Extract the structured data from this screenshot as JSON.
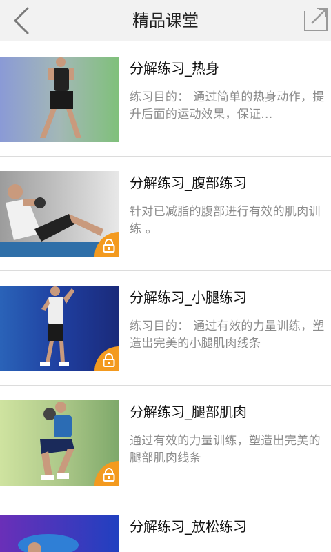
{
  "header": {
    "title": "精品课堂",
    "back_icon": "chevron-left-icon",
    "share_icon": "share-icon"
  },
  "lessons": [
    {
      "title": "分解练习_热身",
      "desc": "练习目的： 通过简单的热身动作，提升后面的运动效果，保证...",
      "locked": false
    },
    {
      "title": "分解练习_腹部练习",
      "desc": "针对已减脂的腹部进行有效的肌肉训练 。",
      "locked": true
    },
    {
      "title": "分解练习_小腿练习",
      "desc": "练习目的： 通过有效的力量训练，塑造出完美的小腿肌肉线条",
      "locked": true
    },
    {
      "title": "分解练习_腿部肌肉",
      "desc": "通过有效的力量训练，塑造出完美的腿部肌肉线条",
      "locked": true
    },
    {
      "title": "分解练习_放松练习",
      "desc": "",
      "locked": false
    }
  ],
  "colors": {
    "lock_badge": "#f39a1f",
    "header_bg": "#f2f2f2",
    "desc_text": "#8c8c8c"
  }
}
